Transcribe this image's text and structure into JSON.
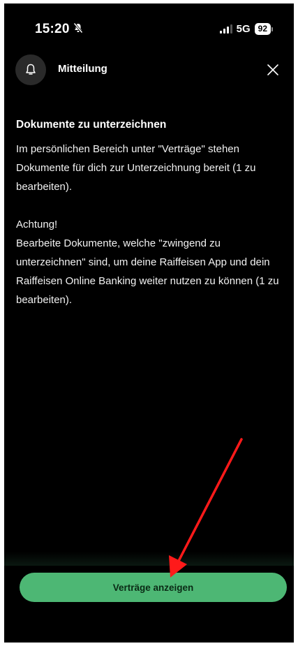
{
  "status_bar": {
    "time": "15:20",
    "network": "5G",
    "battery": "92",
    "icons": [
      "bell-slash-icon",
      "signal-icon",
      "battery-icon"
    ]
  },
  "header": {
    "title": "Mitteilung",
    "icon": "bell-icon",
    "close_icon": "close-icon"
  },
  "content": {
    "title": "Dokumente zu unterzeichnen",
    "paragraph1": "Im persönlichen Bereich unter \"Verträge\" stehen Dokumente für dich zur Unterzeichnung bereit (1 zu bearbeiten).",
    "paragraph2_heading": "Achtung!",
    "paragraph2": "Bearbeite Dokumente, welche \"zwingend zu unterzeichnen\" sind, um deine Raiffeisen App und dein Raiffeisen Online Banking weiter nutzen zu können (1 zu bearbeiten)."
  },
  "action": {
    "button_label": "Verträge anzeigen"
  },
  "colors": {
    "background": "#000000",
    "button": "#4db774",
    "button_text": "#0a2a15",
    "annotation_arrow": "#ff1a1a"
  }
}
